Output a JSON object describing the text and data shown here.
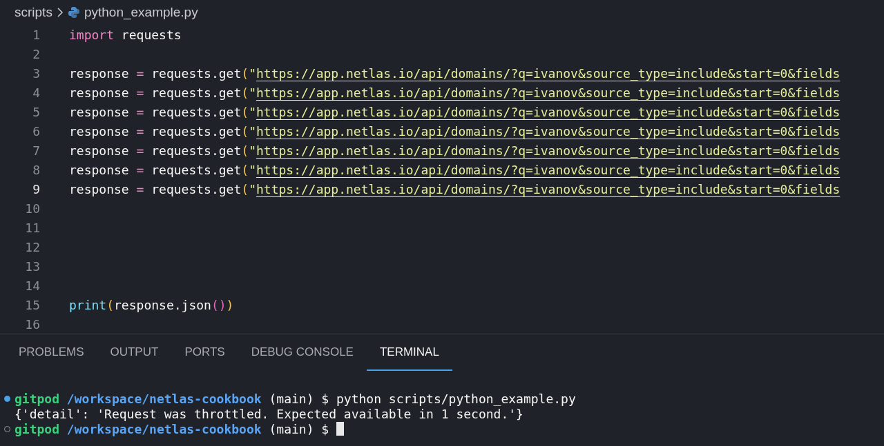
{
  "breadcrumb": [
    {
      "label": "scripts",
      "kind": "folder"
    },
    {
      "label": "python_example.py",
      "kind": "python-file"
    }
  ],
  "editor": {
    "lines": [
      {
        "number": "1",
        "current": false,
        "tokens": [
          {
            "kind": "keyword",
            "text": "import"
          },
          {
            "kind": "plain",
            "text": " requests"
          }
        ]
      },
      {
        "number": "2",
        "current": false
      },
      {
        "number": "3",
        "current": false,
        "tokens": [
          {
            "kind": "plain",
            "text": "response "
          },
          {
            "kind": "operator",
            "text": "="
          },
          {
            "kind": "plain",
            "text": " requests.get"
          },
          {
            "kind": "bracket",
            "text": "("
          },
          {
            "kind": "string",
            "text": "\""
          },
          {
            "kind": "url",
            "text": "https://app.netlas.io/api/domains/?q=ivanov&source_type=include&start=0&fields"
          }
        ]
      },
      {
        "number": "4",
        "current": false,
        "tokens": [
          {
            "kind": "plain",
            "text": "response "
          },
          {
            "kind": "operator",
            "text": "="
          },
          {
            "kind": "plain",
            "text": " requests.get"
          },
          {
            "kind": "bracket",
            "text": "("
          },
          {
            "kind": "string",
            "text": "\""
          },
          {
            "kind": "url",
            "text": "https://app.netlas.io/api/domains/?q=ivanov&source_type=include&start=0&fields"
          }
        ]
      },
      {
        "number": "5",
        "current": false,
        "tokens": [
          {
            "kind": "plain",
            "text": "response "
          },
          {
            "kind": "operator",
            "text": "="
          },
          {
            "kind": "plain",
            "text": " requests.get"
          },
          {
            "kind": "bracket",
            "text": "("
          },
          {
            "kind": "string",
            "text": "\""
          },
          {
            "kind": "url",
            "text": "https://app.netlas.io/api/domains/?q=ivanov&source_type=include&start=0&fields"
          }
        ]
      },
      {
        "number": "6",
        "current": false,
        "tokens": [
          {
            "kind": "plain",
            "text": "response "
          },
          {
            "kind": "operator",
            "text": "="
          },
          {
            "kind": "plain",
            "text": " requests.get"
          },
          {
            "kind": "bracket",
            "text": "("
          },
          {
            "kind": "string",
            "text": "\""
          },
          {
            "kind": "url",
            "text": "https://app.netlas.io/api/domains/?q=ivanov&source_type=include&start=0&fields"
          }
        ]
      },
      {
        "number": "7",
        "current": false,
        "tokens": [
          {
            "kind": "plain",
            "text": "response "
          },
          {
            "kind": "operator",
            "text": "="
          },
          {
            "kind": "plain",
            "text": " requests.get"
          },
          {
            "kind": "bracket",
            "text": "("
          },
          {
            "kind": "string",
            "text": "\""
          },
          {
            "kind": "url",
            "text": "https://app.netlas.io/api/domains/?q=ivanov&source_type=include&start=0&fields"
          }
        ]
      },
      {
        "number": "8",
        "current": false,
        "tokens": [
          {
            "kind": "plain",
            "text": "response "
          },
          {
            "kind": "operator",
            "text": "="
          },
          {
            "kind": "plain",
            "text": " requests.get"
          },
          {
            "kind": "bracket",
            "text": "("
          },
          {
            "kind": "string",
            "text": "\""
          },
          {
            "kind": "url",
            "text": "https://app.netlas.io/api/domains/?q=ivanov&source_type=include&start=0&fields"
          }
        ]
      },
      {
        "number": "9",
        "current": true,
        "tokens": [
          {
            "kind": "plain",
            "text": "response "
          },
          {
            "kind": "operator",
            "text": "="
          },
          {
            "kind": "plain",
            "text": " requests.get"
          },
          {
            "kind": "bracket",
            "text": "("
          },
          {
            "kind": "string",
            "text": "\""
          },
          {
            "kind": "url",
            "text": "https://app.netlas.io/api/domains/?q=ivanov&source_type=include&start=0&fields"
          }
        ]
      },
      {
        "number": "10",
        "current": false
      },
      {
        "number": "11",
        "current": false
      },
      {
        "number": "12",
        "current": false
      },
      {
        "number": "13",
        "current": false
      },
      {
        "number": "14",
        "current": false
      },
      {
        "number": "15",
        "current": false,
        "tokens": [
          {
            "kind": "builtin",
            "text": "print"
          },
          {
            "kind": "bracket",
            "text": "("
          },
          {
            "kind": "plain",
            "text": "response.json"
          },
          {
            "kind": "bracket2",
            "text": "()"
          },
          {
            "kind": "bracket",
            "text": ")"
          }
        ]
      },
      {
        "number": "16",
        "current": false
      }
    ]
  },
  "panel": {
    "tabs": [
      {
        "label": "PROBLEMS",
        "selected": false
      },
      {
        "label": "OUTPUT",
        "selected": false
      },
      {
        "label": "PORTS",
        "selected": false
      },
      {
        "label": "DEBUG CONSOLE",
        "selected": false
      },
      {
        "label": "TERMINAL",
        "selected": true
      }
    ],
    "terminal": [
      {
        "kind": "command",
        "active": true,
        "tokens": [
          {
            "kind": "user",
            "text": "gitpod"
          },
          {
            "kind": "path",
            "text": " /workspace/netlas-cookbook"
          },
          {
            "kind": "plain",
            "text": " (main) $ python scripts/python_example.py"
          }
        ]
      },
      {
        "kind": "output",
        "tokens": [
          {
            "kind": "plain",
            "text": "{'detail': 'Request was throttled. Expected available in 1 second.'}"
          }
        ]
      },
      {
        "kind": "command",
        "active": false,
        "cursor": true,
        "tokens": [
          {
            "kind": "user",
            "text": "gitpod"
          },
          {
            "kind": "path",
            "text": " /workspace/netlas-cookbook"
          },
          {
            "kind": "plain",
            "text": " (main) $ "
          }
        ]
      }
    ]
  }
}
